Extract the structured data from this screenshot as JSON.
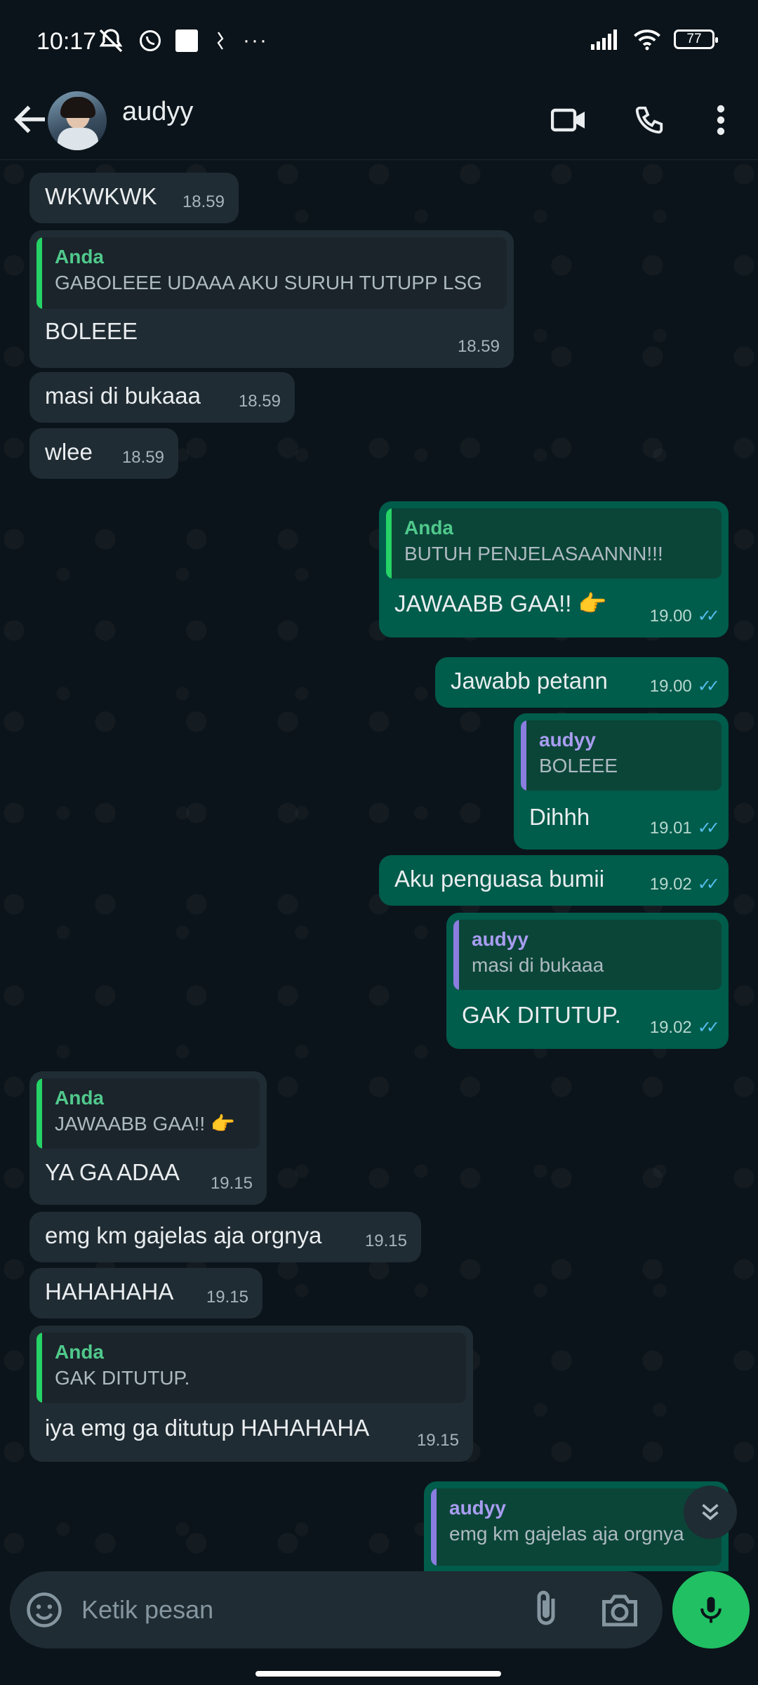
{
  "status_bar": {
    "time": "10:17",
    "battery": "77"
  },
  "header": {
    "contact_name": "audyy"
  },
  "messages": [
    {
      "text": "WKWKWK",
      "time": "18.59"
    },
    {
      "quote_author": "Anda",
      "quote_text": "GABOLEEE UDAAA AKU SURUH TUTUPP LSG",
      "text": "BOLEEE",
      "time": "18.59"
    },
    {
      "text": "masi di bukaaa",
      "time": "18.59"
    },
    {
      "text": "wlee",
      "time": "18.59"
    },
    {
      "quote_author": "Anda",
      "quote_text": "BUTUH PENJELASAANNN!!!",
      "text": "JAWAABB GAA!! 👉",
      "time": "19.00"
    },
    {
      "text": "Jawabb petann",
      "time": "19.00"
    },
    {
      "quote_author": "audyy",
      "quote_text": "BOLEEE",
      "text": "Dihhh",
      "time": "19.01"
    },
    {
      "text": "Aku penguasa bumii",
      "time": "19.02"
    },
    {
      "quote_author": "audyy",
      "quote_text": "masi di bukaaa",
      "text": "GAK DITUTUP.",
      "time": "19.02"
    },
    {
      "quote_author": "Anda",
      "quote_text": "JAWAABB GAA!! 👉",
      "text": "YA GA ADAA",
      "time": "19.15"
    },
    {
      "text": "emg km gajelas aja orgnya",
      "time": "19.15"
    },
    {
      "text": "HAHAHAHA",
      "time": "19.15"
    },
    {
      "quote_author": "Anda",
      "quote_text": "GAK DITUTUP.",
      "text": "iya emg ga ditutup HAHAHAHA",
      "time": "19.15"
    },
    {
      "quote_author": "audyy",
      "quote_text": "emg km gajelas aja orgnya"
    }
  ],
  "composer": {
    "placeholder": "Ketik pesan"
  },
  "colors": {
    "incoming": "#202c33",
    "outgoing": "#005c4b",
    "accent": "#21c063",
    "read_ticks": "#53bdeb"
  }
}
